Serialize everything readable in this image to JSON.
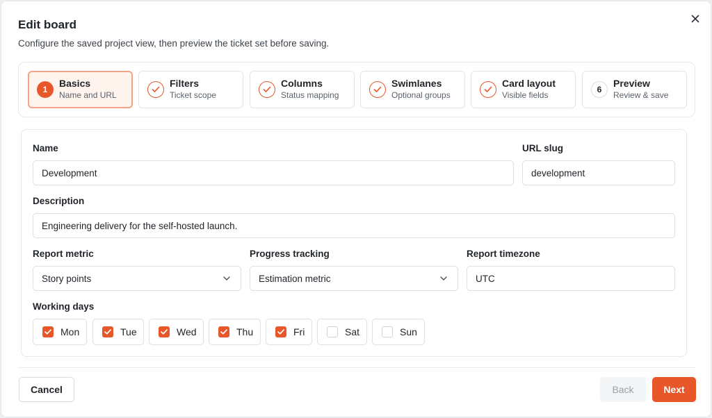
{
  "dialog": {
    "title": "Edit board",
    "subtitle": "Configure the saved project view, then preview the ticket set before saving."
  },
  "steps": [
    {
      "number": "1",
      "title": "Basics",
      "subtitle": "Name and URL",
      "state": "active"
    },
    {
      "number": "",
      "title": "Filters",
      "subtitle": "Ticket scope",
      "state": "done"
    },
    {
      "number": "",
      "title": "Columns",
      "subtitle": "Status mapping",
      "state": "done"
    },
    {
      "number": "",
      "title": "Swimlanes",
      "subtitle": "Optional groups",
      "state": "done"
    },
    {
      "number": "",
      "title": "Card layout",
      "subtitle": "Visible fields",
      "state": "done"
    },
    {
      "number": "6",
      "title": "Preview",
      "subtitle": "Review & save",
      "state": "todo"
    }
  ],
  "form": {
    "name": {
      "label": "Name",
      "value": "Development"
    },
    "slug": {
      "label": "URL slug",
      "value": "development"
    },
    "description": {
      "label": "Description",
      "value": "Engineering delivery for the self-hosted launch."
    },
    "report_metric": {
      "label": "Report metric",
      "value": "Story points"
    },
    "progress_tracking": {
      "label": "Progress tracking",
      "value": "Estimation metric"
    },
    "timezone": {
      "label": "Report timezone",
      "value": "UTC"
    },
    "working_days": {
      "label": "Working days",
      "days": [
        {
          "label": "Mon",
          "checked": true
        },
        {
          "label": "Tue",
          "checked": true
        },
        {
          "label": "Wed",
          "checked": true
        },
        {
          "label": "Thu",
          "checked": true
        },
        {
          "label": "Fri",
          "checked": true
        },
        {
          "label": "Sat",
          "checked": false
        },
        {
          "label": "Sun",
          "checked": false
        }
      ]
    }
  },
  "footer": {
    "cancel_label": "Cancel",
    "back_label": "Back",
    "next_label": "Next"
  },
  "colors": {
    "accent": "#e8572a",
    "active_step_bg": "#fff3ee",
    "active_step_border": "#f2a388"
  },
  "icons": {
    "close": "close-icon",
    "done_step": "check-icon",
    "select": "chevron-down-icon",
    "checkbox": "checkmark-icon"
  }
}
